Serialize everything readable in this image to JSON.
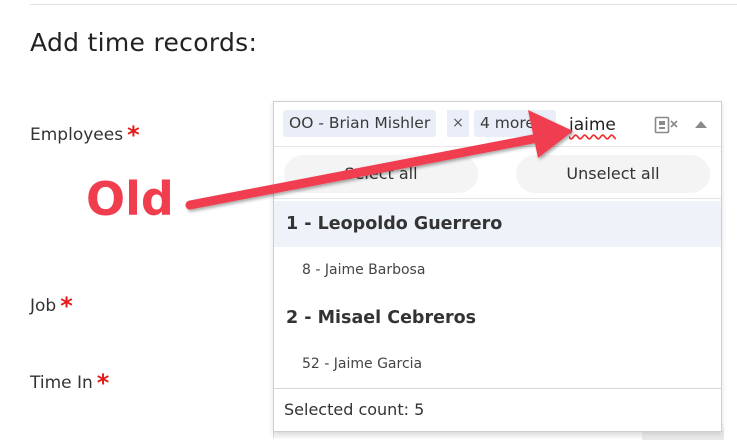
{
  "page": {
    "title": "Add time records:"
  },
  "form": {
    "employees_label": "Employees",
    "job_label": "Job",
    "time_in_label": "Time In",
    "required_mark": "*"
  },
  "multiselect": {
    "chips": [
      {
        "label": "OO - Brian Mishler",
        "remove_label": "×"
      },
      {
        "label": "4 more..."
      }
    ],
    "search_value": "jaime",
    "select_all_label": "Select all",
    "unselect_all_label": "Unselect all",
    "options": [
      {
        "type": "group",
        "label": "1 - Leopoldo Guerrero"
      },
      {
        "type": "item",
        "label": "8 - Jaime Barbosa"
      },
      {
        "type": "group",
        "label": "2 - Misael Cebreros"
      },
      {
        "type": "item",
        "label": "52 - Jaime Garcia"
      }
    ],
    "selected_count_label": "Selected count: 5"
  },
  "annotation": {
    "label": "Old",
    "color": "#f03e4f"
  },
  "icons": {
    "clear": "clear-selection-icon",
    "caret": "caret-up-icon"
  }
}
